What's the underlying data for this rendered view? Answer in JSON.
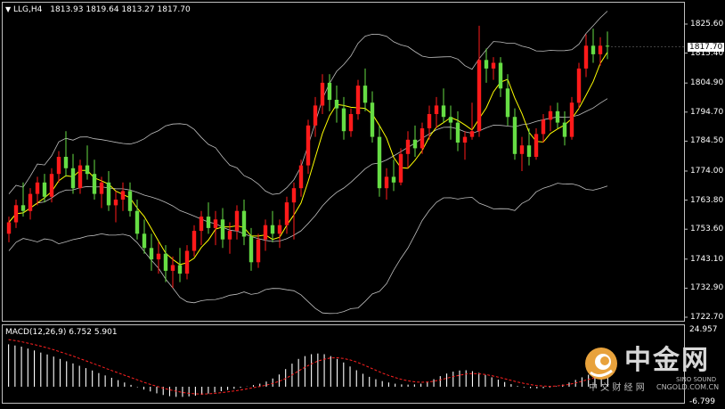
{
  "window": {
    "symbol_label": "LLG,H4",
    "ohlc": "1813.93 1819.64 1813.27 1817.70",
    "current_price": "1817.70",
    "dropdown_icon": "triangle-down-icon"
  },
  "price_axis": {
    "ticks": [
      "1825.60",
      "1815.40",
      "1804.90",
      "1794.70",
      "1784.50",
      "1774.00",
      "1763.80",
      "1753.60",
      "1743.10",
      "1732.90",
      "1722.70"
    ],
    "range": [
      1722.7,
      1825.6
    ]
  },
  "macd": {
    "label": "MACD(12,26,9) 6.752 5.901",
    "ticks": [
      "24.957",
      "-6.799"
    ],
    "range": [
      -6.799,
      24.957
    ]
  },
  "watermark": {
    "brand_cn": "中金网",
    "sub_cn": "中 文 财 经 网",
    "sub_en": "CNGOLD.COM.CN",
    "sino": "SINO SOUND",
    "logo_icon": "cngold-logo-icon"
  },
  "colors": {
    "background": "#000000",
    "bull": "#ff1a1a",
    "bear": "#66dd44",
    "bands": "#bfbfbf",
    "ma": "#ffff00",
    "macd_hist": "#ffffff",
    "macd_signal": "#ff2020",
    "logo": "#e8a23c"
  },
  "chart_data": {
    "type": "candlestick",
    "title": "LLG,H4",
    "overlays": [
      "Bollinger Bands",
      "Moving Average"
    ],
    "indicator": "MACD(12,26,9)",
    "ylim": [
      1722.7,
      1825.6
    ],
    "grid": false,
    "candles": [
      [
        1752.0,
        1758.0,
        1749.0,
        1756.0
      ],
      [
        1756.0,
        1764.0,
        1754.0,
        1762.0
      ],
      [
        1762.0,
        1770.0,
        1758.0,
        1760.0
      ],
      [
        1760.0,
        1768.0,
        1757.0,
        1766.0
      ],
      [
        1766.0,
        1772.0,
        1762.0,
        1770.0
      ],
      [
        1770.0,
        1773.0,
        1763.0,
        1765.0
      ],
      [
        1765.0,
        1775.0,
        1763.0,
        1773.0
      ],
      [
        1773.0,
        1781.0,
        1770.0,
        1779.0
      ],
      [
        1779.0,
        1788.0,
        1772.0,
        1775.0
      ],
      [
        1775.0,
        1780.0,
        1766.0,
        1768.0
      ],
      [
        1768.0,
        1778.0,
        1766.0,
        1776.0
      ],
      [
        1776.0,
        1783.0,
        1771.0,
        1773.0
      ],
      [
        1773.0,
        1778.0,
        1764.0,
        1766.0
      ],
      [
        1766.0,
        1772.0,
        1761.0,
        1770.0
      ],
      [
        1770.0,
        1774.0,
        1760.0,
        1762.0
      ],
      [
        1762.0,
        1767.0,
        1756.0,
        1764.0
      ],
      [
        1764.0,
        1770.0,
        1760.0,
        1767.0
      ],
      [
        1767.0,
        1770.0,
        1758.0,
        1760.0
      ],
      [
        1760.0,
        1764.0,
        1750.0,
        1752.0
      ],
      [
        1752.0,
        1757.0,
        1745.0,
        1747.0
      ],
      [
        1747.0,
        1752.0,
        1739.0,
        1743.0
      ],
      [
        1743.0,
        1749.0,
        1738.0,
        1745.0
      ],
      [
        1745.0,
        1748.0,
        1735.0,
        1739.0
      ],
      [
        1739.0,
        1744.0,
        1733.0,
        1741.0
      ],
      [
        1741.0,
        1747.0,
        1735.0,
        1738.0
      ],
      [
        1738.0,
        1748.0,
        1736.0,
        1746.0
      ],
      [
        1746.0,
        1755.0,
        1744.0,
        1753.0
      ],
      [
        1753.0,
        1760.0,
        1748.0,
        1758.0
      ],
      [
        1758.0,
        1763.0,
        1752.0,
        1754.0
      ],
      [
        1754.0,
        1760.0,
        1748.0,
        1757.0
      ],
      [
        1757.0,
        1761.0,
        1747.0,
        1750.0
      ],
      [
        1750.0,
        1756.0,
        1745.0,
        1753.0
      ],
      [
        1753.0,
        1762.0,
        1750.0,
        1760.0
      ],
      [
        1760.0,
        1764.0,
        1748.0,
        1751.0
      ],
      [
        1751.0,
        1754.0,
        1739.0,
        1742.0
      ],
      [
        1742.0,
        1752.0,
        1740.0,
        1750.0
      ],
      [
        1750.0,
        1757.0,
        1746.0,
        1755.0
      ],
      [
        1755.0,
        1760.0,
        1749.0,
        1752.0
      ],
      [
        1752.0,
        1757.0,
        1747.0,
        1755.0
      ],
      [
        1755.0,
        1765.0,
        1752.0,
        1763.0
      ],
      [
        1763.0,
        1770.0,
        1750.0,
        1768.0
      ],
      [
        1768.0,
        1778.0,
        1765.0,
        1776.0
      ],
      [
        1776.0,
        1792.0,
        1773.0,
        1790.0
      ],
      [
        1790.0,
        1800.0,
        1786.0,
        1797.0
      ],
      [
        1797.0,
        1808.0,
        1794.0,
        1805.0
      ],
      [
        1805.0,
        1808.0,
        1795.0,
        1799.0
      ],
      [
        1799.0,
        1804.0,
        1791.0,
        1796.0
      ],
      [
        1796.0,
        1800.0,
        1785.0,
        1788.0
      ],
      [
        1788.0,
        1796.0,
        1786.0,
        1794.0
      ],
      [
        1794.0,
        1806.0,
        1792.0,
        1804.0
      ],
      [
        1804.0,
        1810.0,
        1795.0,
        1798.0
      ],
      [
        1798.0,
        1802.0,
        1784.0,
        1786.0
      ],
      [
        1786.0,
        1790.0,
        1765.0,
        1768.0
      ],
      [
        1768.0,
        1775.0,
        1764.0,
        1772.0
      ],
      [
        1772.0,
        1778.0,
        1767.0,
        1770.0
      ],
      [
        1770.0,
        1782.0,
        1769.0,
        1780.0
      ],
      [
        1780.0,
        1788.0,
        1775.0,
        1785.0
      ],
      [
        1785.0,
        1790.0,
        1779.0,
        1782.0
      ],
      [
        1782.0,
        1791.0,
        1780.0,
        1789.0
      ],
      [
        1789.0,
        1797.0,
        1785.0,
        1794.0
      ],
      [
        1794.0,
        1800.0,
        1789.0,
        1797.0
      ],
      [
        1797.0,
        1803.0,
        1791.0,
        1793.0
      ],
      [
        1793.0,
        1797.0,
        1785.0,
        1791.0
      ],
      [
        1791.0,
        1795.0,
        1781.0,
        1784.0
      ],
      [
        1784.0,
        1788.0,
        1778.0,
        1786.0
      ],
      [
        1786.0,
        1798.0,
        1785.0,
        1788.0
      ],
      [
        1788.0,
        1825.0,
        1786.0,
        1813.0
      ],
      [
        1813.0,
        1817.0,
        1805.0,
        1810.0
      ],
      [
        1810.0,
        1814.0,
        1806.0,
        1812.0
      ],
      [
        1812.0,
        1814.0,
        1800.0,
        1803.0
      ],
      [
        1803.0,
        1808.0,
        1790.0,
        1793.0
      ],
      [
        1793.0,
        1796.0,
        1778.0,
        1780.0
      ],
      [
        1780.0,
        1786.0,
        1774.0,
        1783.0
      ],
      [
        1783.0,
        1789.0,
        1776.0,
        1779.0
      ],
      [
        1779.0,
        1789.0,
        1778.0,
        1787.0
      ],
      [
        1787.0,
        1794.0,
        1784.0,
        1792.0
      ],
      [
        1792.0,
        1797.0,
        1788.0,
        1795.0
      ],
      [
        1795.0,
        1798.0,
        1789.0,
        1791.0
      ],
      [
        1791.0,
        1795.0,
        1783.0,
        1786.0
      ],
      [
        1786.0,
        1800.0,
        1785.0,
        1798.0
      ],
      [
        1798.0,
        1812.0,
        1796.0,
        1810.0
      ],
      [
        1810.0,
        1822.0,
        1807.0,
        1818.0
      ],
      [
        1818.0,
        1824.0,
        1812.0,
        1815.0
      ],
      [
        1815.0,
        1821.0,
        1811.0,
        1818.0
      ],
      [
        1818.0,
        1823.0,
        1813.3,
        1817.7
      ]
    ],
    "macd_histogram": [
      18.0,
      17.5,
      17.0,
      16.2,
      15.4,
      14.5,
      13.7,
      12.8,
      11.8,
      10.8,
      9.9,
      8.9,
      7.9,
      6.9,
      5.8,
      4.8,
      3.8,
      2.8,
      1.8,
      0.8,
      -0.2,
      -1.2,
      -2.0,
      -2.8,
      -3.5,
      -4.0,
      -4.3,
      -4.3,
      -4.1,
      -3.8,
      -3.4,
      -2.9,
      -2.4,
      -1.9,
      -1.4,
      -0.9,
      -0.4,
      0.1,
      0.7,
      1.3,
      2.2,
      3.5,
      5.2,
      7.5,
      9.8,
      11.8,
      13.0,
      13.8,
      14.1,
      13.8,
      13.0,
      11.8,
      10.3,
      8.6,
      7.0,
      5.5,
      4.2,
      3.2,
      2.4,
      1.8,
      1.3,
      1.0,
      0.9,
      1.0,
      1.3,
      2.0,
      3.2,
      4.5,
      5.6,
      6.4,
      6.9,
      7.0,
      6.6,
      5.9,
      5.0,
      4.0,
      3.0,
      2.0,
      1.1,
      0.3,
      -0.3,
      -0.6,
      -0.7,
      -0.6,
      -0.3,
      0.2,
      0.9,
      1.8,
      2.9,
      4.0,
      5.1,
      6.0,
      6.5,
      6.75
    ],
    "macd_signal": [
      20.0,
      19.6,
      19.1,
      18.5,
      17.9,
      17.2,
      16.5,
      15.7,
      14.8,
      13.9,
      13.0,
      12.0,
      11.0,
      10.0,
      9.0,
      7.9,
      6.9,
      5.9,
      4.9,
      3.9,
      2.9,
      1.9,
      1.0,
      0.2,
      -0.6,
      -1.3,
      -1.9,
      -2.4,
      -2.8,
      -3.0,
      -3.1,
      -3.0,
      -2.8,
      -2.5,
      -2.2,
      -1.8,
      -1.4,
      -0.9,
      -0.4,
      0.1,
      0.7,
      1.4,
      2.3,
      3.5,
      5.0,
      6.7,
      8.3,
      9.7,
      10.9,
      11.7,
      12.2,
      12.3,
      12.0,
      11.4,
      10.5,
      9.4,
      8.2,
      7.0,
      5.8,
      4.8,
      3.9,
      3.1,
      2.5,
      2.1,
      1.9,
      2.0,
      2.3,
      2.9,
      3.6,
      4.3,
      4.9,
      5.4,
      5.6,
      5.5,
      5.2,
      4.7,
      4.1,
      3.4,
      2.7,
      2.0,
      1.4,
      0.9,
      0.5,
      0.3,
      0.2,
      0.3,
      0.6,
      1.0,
      1.6,
      2.3,
      3.1,
      3.9,
      4.7,
      5.3,
      5.9
    ]
  }
}
